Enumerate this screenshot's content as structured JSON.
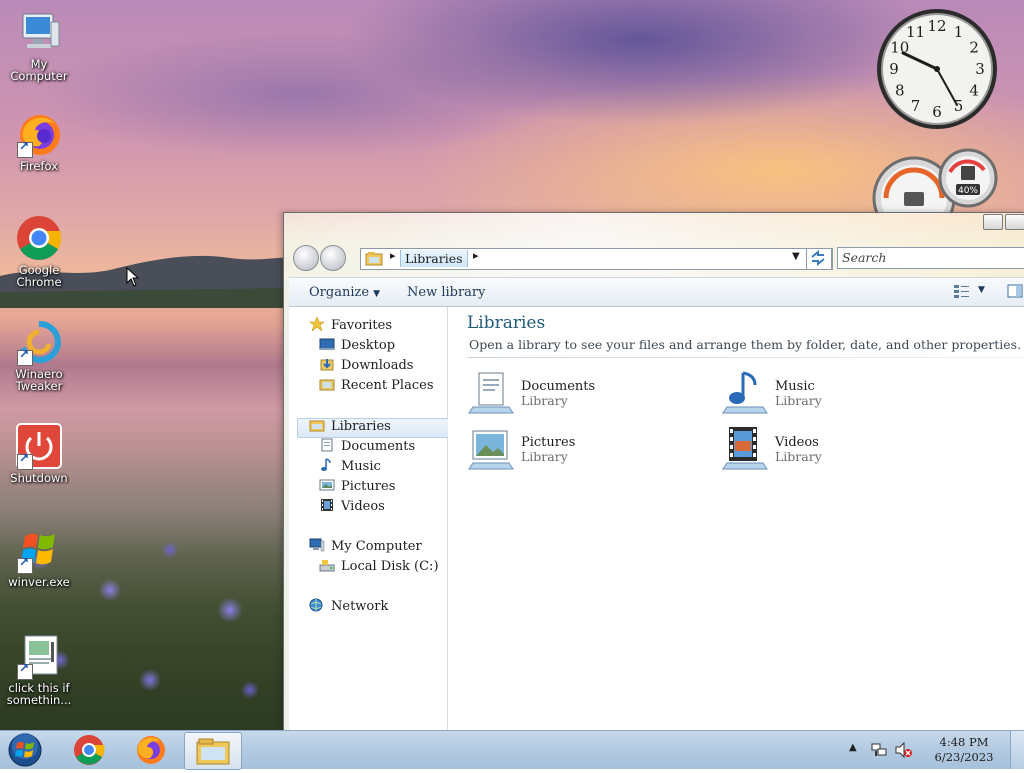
{
  "desktop": {
    "icons": [
      {
        "label_line1": "My",
        "label_line2": "Computer",
        "icon": "computer-icon"
      },
      {
        "label_line1": "Firefox",
        "label_line2": "",
        "icon": "firefox-icon"
      },
      {
        "label_line1": "Google",
        "label_line2": "Chrome",
        "icon": "chrome-icon"
      },
      {
        "label_line1": "Winaero",
        "label_line2": "Tweaker",
        "icon": "winaero-tweaker-icon"
      },
      {
        "label_line1": "Shutdown",
        "label_line2": "",
        "icon": "shutdown-icon"
      },
      {
        "label_line1": "winver.exe",
        "label_line2": "",
        "icon": "winver-icon"
      },
      {
        "label_line1": "click this if",
        "label_line2": "somethin...",
        "icon": "document-icon"
      }
    ]
  },
  "gadgets": {
    "clock_numbers": [
      "12",
      "1",
      "2",
      "3",
      "4",
      "5",
      "6",
      "7",
      "8",
      "9",
      "10",
      "11"
    ],
    "meter_label": "40%"
  },
  "explorer": {
    "address_crumb": "Libraries",
    "search_placeholder": "Search",
    "toolbar": {
      "organize": "Organize",
      "new_library": "New library"
    },
    "nav": {
      "favorites": "Favorites",
      "desktop": "Desktop",
      "downloads": "Downloads",
      "recent_places": "Recent Places",
      "libraries": "Libraries",
      "documents": "Documents",
      "music": "Music",
      "pictures": "Pictures",
      "videos": "Videos",
      "my_computer": "My Computer",
      "local_disk": "Local Disk (C:)",
      "network": "Network"
    },
    "content": {
      "title": "Libraries",
      "subtitle": "Open a library to see your files and arrange them by folder, date, and other properties.",
      "libraries": [
        {
          "name": "Documents",
          "type": "Library"
        },
        {
          "name": "Music",
          "type": "Library"
        },
        {
          "name": "Pictures",
          "type": "Library"
        },
        {
          "name": "Videos",
          "type": "Library"
        }
      ]
    }
  },
  "taskbar": {
    "time": "4:48 PM",
    "date": "6/23/2023"
  },
  "colors": {
    "link_blue": "#1e5a7a",
    "taskbar": "#b3cbe2"
  }
}
